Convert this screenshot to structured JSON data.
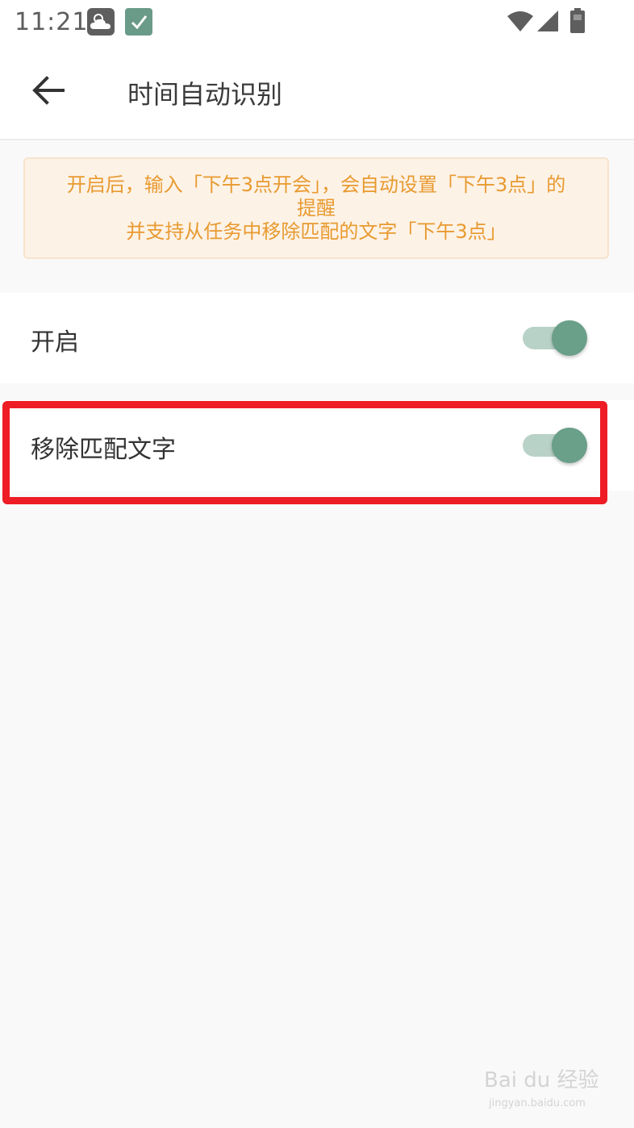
{
  "status_bar": {
    "time": "11:21",
    "icons": [
      "weather-icon",
      "app-check-icon",
      "wifi-icon",
      "signal-icon",
      "battery-icon"
    ]
  },
  "app_bar": {
    "back_icon": "arrow-left-icon",
    "title": "时间自动识别"
  },
  "notice": {
    "line1": "开启后，输入「下午3点开会」，会自动设置「下午3点」的提醒",
    "line2": "并支持从任务中移除匹配的文字「下午3点」",
    "color": "#e89a30",
    "background": "#fdf2e6"
  },
  "settings": [
    {
      "label": "开启",
      "enabled": true
    },
    {
      "label": "移除匹配文字",
      "enabled": true
    }
  ],
  "accent_color": "#6a9f8a",
  "highlight_color": "#ee1c25",
  "watermark": {
    "brand": "Bai du 经验",
    "url": "jingyan.baidu.com"
  }
}
